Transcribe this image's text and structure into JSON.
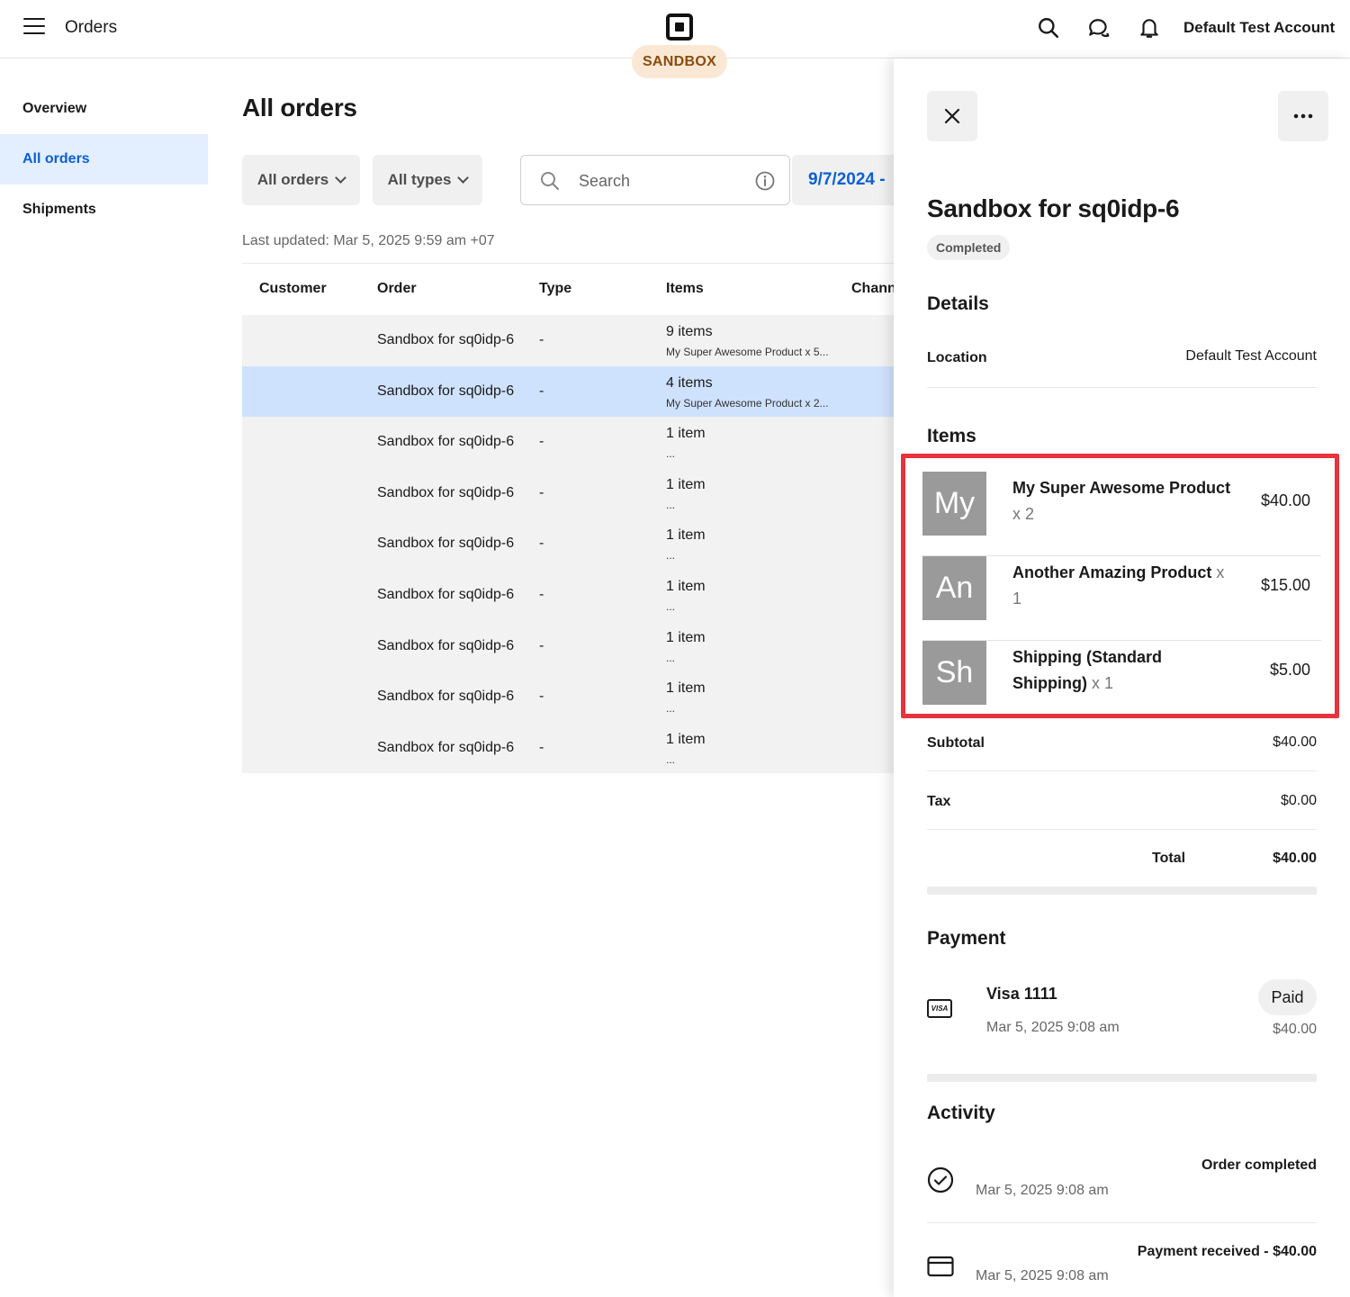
{
  "header": {
    "title": "Orders",
    "badge": "SANDBOX",
    "account": "Default Test Account"
  },
  "sidebar": {
    "items": [
      {
        "label": "Overview"
      },
      {
        "label": "All orders"
      },
      {
        "label": "Shipments"
      }
    ]
  },
  "main": {
    "title": "All orders",
    "filters": {
      "orders": "All orders",
      "types": "All types",
      "search_placeholder": "Search",
      "date": "9/7/2024 -"
    },
    "last_updated": "Last updated: Mar 5, 2025 9:59 am +07",
    "columns": {
      "customer": "Customer",
      "order": "Order",
      "type": "Type",
      "items": "Items",
      "channel": "Channel"
    },
    "rows": [
      {
        "order": "Sandbox for sq0idp-6",
        "type": "-",
        "items": "9 items",
        "sub": "My Super Awesome Product x 5..."
      },
      {
        "order": "Sandbox for sq0idp-6",
        "type": "-",
        "items": "4 items",
        "sub": "My Super Awesome Product x 2..."
      },
      {
        "order": "Sandbox for sq0idp-6",
        "type": "-",
        "items": "1 item",
        "sub": "..."
      },
      {
        "order": "Sandbox for sq0idp-6",
        "type": "-",
        "items": "1 item",
        "sub": "..."
      },
      {
        "order": "Sandbox for sq0idp-6",
        "type": "-",
        "items": "1 item",
        "sub": "..."
      },
      {
        "order": "Sandbox for sq0idp-6",
        "type": "-",
        "items": "1 item",
        "sub": "..."
      },
      {
        "order": "Sandbox for sq0idp-6",
        "type": "-",
        "items": "1 item",
        "sub": "..."
      },
      {
        "order": "Sandbox for sq0idp-6",
        "type": "-",
        "items": "1 item",
        "sub": "..."
      },
      {
        "order": "Sandbox for sq0idp-6",
        "type": "-",
        "items": "1 item",
        "sub": "..."
      }
    ]
  },
  "panel": {
    "title": "Sandbox for sq0idp-6",
    "status": "Completed",
    "details": {
      "heading": "Details",
      "location_label": "Location",
      "location_value": "Default Test Account"
    },
    "items_heading": "Items",
    "items": [
      {
        "thumb": "My",
        "name": "My Super Awesome Product",
        "qty": "x 2",
        "price": "$40.00"
      },
      {
        "thumb": "An",
        "name": "Another Amazing Product",
        "qty": "x 1",
        "price": "$15.00"
      },
      {
        "thumb": "Sh",
        "name": "Shipping (Standard Shipping)",
        "qty": "x 1",
        "price": "$5.00"
      }
    ],
    "totals": {
      "subtotal_label": "Subtotal",
      "subtotal": "$40.00",
      "tax_label": "Tax",
      "tax": "$0.00",
      "total_label": "Total",
      "total": "$40.00"
    },
    "payment": {
      "heading": "Payment",
      "card_icon_text": "VISA",
      "card": "Visa 1111",
      "date": "Mar 5, 2025 9:08 am",
      "status": "Paid",
      "amount": "$40.00"
    },
    "activity": {
      "heading": "Activity",
      "events": [
        {
          "title": "Order completed",
          "date": "Mar 5, 2025 9:08 am"
        },
        {
          "title": "Payment received - $40.00",
          "date": "Mar 5, 2025 9:08 am"
        }
      ]
    }
  },
  "colors": {
    "accent": "#0b5fd2",
    "selected_row": "#cfe2fd",
    "highlight": "#e8323c",
    "sandbox_bg": "#fbe8d4"
  }
}
